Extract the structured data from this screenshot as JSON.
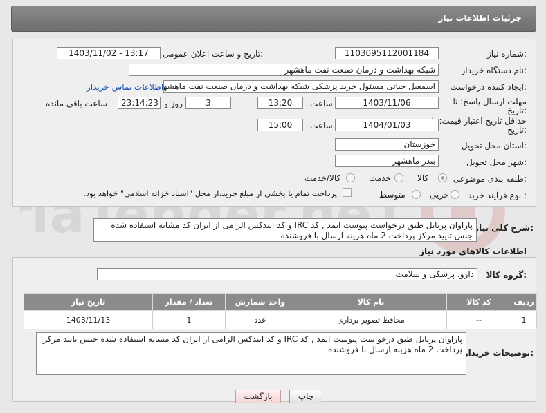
{
  "header": {
    "title": "جزئیات اطلاعات نیاز"
  },
  "form": {
    "need_number_label": "شماره نیاز:",
    "need_number": "1103095112001184",
    "announce_label": "تاریخ و ساعت اعلان عمومی:",
    "announce_value": "1403/11/02 - 13:17",
    "buyer_org_label": "نام دستگاه خریدار:",
    "buyer_org": "شبکه بهداشت و درمان صنعت نفت ماهشهر",
    "creator_label": "ایجاد کننده درخواست:",
    "creator": "اسمعیل حیاتی مسئول خرید پزشکی شبکه بهداشت و درمان صنعت نفت ماهشهر",
    "contact_link": "اطلاعات تماس خریدار",
    "deadline_label_1": "مهلت ارسال پاسخ: تا",
    "deadline_label_2": "تاریخ:",
    "deadline_date": "1403/11/06",
    "time_label": "ساعت",
    "deadline_time": "13:20",
    "days_value": "3",
    "days_label": "روز و",
    "remaining_time": "23:14:23",
    "remaining_label": "ساعت باقی مانده",
    "validity_label_1": "حداقل تاریخ اعتبار قیمت: تا",
    "validity_label_2": "تاریخ:",
    "validity_date": "1404/01/03",
    "validity_time_label": "ساعت",
    "validity_time": "15:00",
    "province_label": "استان محل تحویل:",
    "province": "خوزستان",
    "city_label": "شهر محل تحویل:",
    "city": "بندر ماهشهر",
    "category_label": "طبقه بندی موضوعی:",
    "category_options": [
      "کالا",
      "خدمت",
      "کالا/خدمت"
    ],
    "process_label": "نوع فرآیند خرید :",
    "process_options": [
      "جزیی",
      "متوسط"
    ],
    "payment_note": "پرداخت تمام یا بخشی از مبلغ خرید،از محل \"اسناد خزانه اسلامی\" خواهد بود."
  },
  "summary": {
    "label": "شرح کلی نیاز:",
    "text": "پاراوان پرتابل طبق درخواست پیوست ایمد , کد IRC و کد ایندکس الزامی از ایران کد مشابه استفاده شده جنس تایید مرکز پرداخت 2 ماه هزینه ارسال با فروشنده"
  },
  "goods": {
    "section_title": "اطلاعات کالاهای مورد نیاز",
    "group_label": "گروه کالا:",
    "group_value": "دارو، پزشکی و سلامت",
    "columns": [
      "ردیف",
      "کد کالا",
      "نام کالا",
      "واحد شمارش",
      "تعداد / مقدار",
      "تاریخ نیاز"
    ],
    "rows": [
      [
        "1",
        "--",
        "محافظ تصویر برداری",
        "عدد",
        "1",
        "1403/11/13"
      ]
    ]
  },
  "buyer_notes": {
    "label": "توضیحات خریدار:",
    "text": "پاراوان پرتابل طبق درخواست پیوست ایمد , کد IRC و کد ایندکس الزامی از ایران کد مشابه استفاده شده جنس تایید مرکز پرداخت 2 ماه هزینه ارسال با فروشنده"
  },
  "buttons": {
    "print": "چاپ",
    "back": "بازگشت"
  },
  "watermark": {
    "brand": "AriaTender.neT"
  },
  "colors": {
    "header_bg": "#7a7a7a",
    "link": "#1a4fb0",
    "table_header": "#8b8b8b"
  }
}
